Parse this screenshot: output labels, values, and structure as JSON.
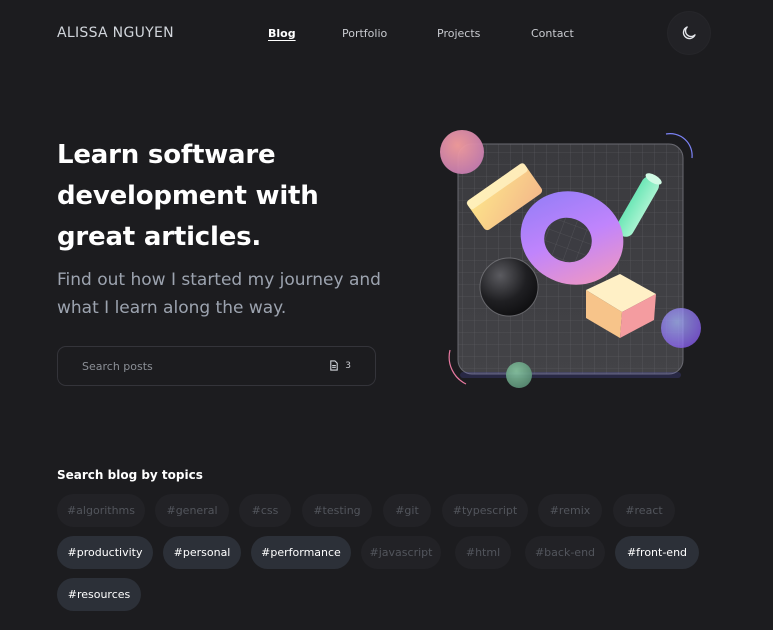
{
  "header": {
    "logo": "ALISSA NGUYEN",
    "nav": [
      {
        "label": "Blog",
        "active": true
      },
      {
        "label": "Portfolio",
        "active": false
      },
      {
        "label": "Projects",
        "active": false
      },
      {
        "label": "Contact",
        "active": false
      }
    ],
    "theme_toggle_icon": "moon-icon"
  },
  "hero": {
    "title": "Learn software development with great articles.",
    "subtitle": "Find out how I started my journey and what I learn along the way."
  },
  "search": {
    "placeholder": "Search posts",
    "value": "",
    "count": "3",
    "count_icon": "document-icon"
  },
  "topics": {
    "title": "Search blog by topics",
    "tags": [
      {
        "label": "#algorithms",
        "selected": false
      },
      {
        "label": "#general",
        "selected": false
      },
      {
        "label": "#css",
        "selected": false
      },
      {
        "label": "#testing",
        "selected": false
      },
      {
        "label": "#git",
        "selected": false
      },
      {
        "label": "#typescript",
        "selected": false
      },
      {
        "label": "#remix",
        "selected": false
      },
      {
        "label": "#react",
        "selected": false
      },
      {
        "label": "#productivity",
        "selected": true
      },
      {
        "label": "#personal",
        "selected": true
      },
      {
        "label": "#performance",
        "selected": true
      },
      {
        "label": "#javascript",
        "selected": false
      },
      {
        "label": "#html",
        "selected": false
      },
      {
        "label": "#back-end",
        "selected": false
      },
      {
        "label": "#front-end",
        "selected": true
      },
      {
        "label": "#resources",
        "selected": true
      }
    ]
  },
  "colors": {
    "background": "#1c1c1f",
    "tag_selected_bg": "#2c3038",
    "tag_unselected_bg": "#222226",
    "tag_unselected_text": "#52555c"
  }
}
